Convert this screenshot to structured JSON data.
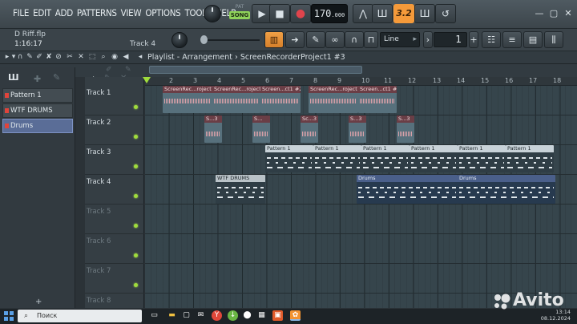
{
  "menu": [
    "FILE",
    "EDIT",
    "ADD",
    "PATTERNS",
    "VIEW",
    "OPTIONS",
    "TOOLS",
    "HELP"
  ],
  "transport": {
    "pat_label": "PAT",
    "song_label": "SONG",
    "play_icon": "play-icon",
    "stop_icon": "stop-icon",
    "record_icon": "record-icon",
    "tempo_int": "170",
    "tempo_frac": ".000",
    "cpu_label": "3.2"
  },
  "info": {
    "filename": "D Riff.flp",
    "time": "1:16:17",
    "hint": "Track 4"
  },
  "snap": {
    "label": "Line",
    "step": "1"
  },
  "playlist": {
    "title": "Playlist - Arrangement",
    "breadcrumb_sep": "›",
    "project": "ScreenRecorderProject1 #3"
  },
  "patterns": [
    {
      "name": "Pattern 1",
      "selected": false
    },
    {
      "name": "WTF DRUMS",
      "selected": false
    },
    {
      "name": "Drums",
      "selected": true
    }
  ],
  "tracks": [
    {
      "name": "Track 1",
      "active": true
    },
    {
      "name": "Track 2",
      "active": true
    },
    {
      "name": "Track 3",
      "active": true
    },
    {
      "name": "Track 4",
      "active": true
    },
    {
      "name": "Track 5",
      "active": false
    },
    {
      "name": "Track 6",
      "active": false
    },
    {
      "name": "Track 7",
      "active": false
    },
    {
      "name": "Track 8",
      "active": false
    }
  ],
  "ruler": [
    "2",
    "3",
    "4",
    "5",
    "6",
    "7",
    "8",
    "9",
    "10",
    "11",
    "12",
    "13",
    "14",
    "15",
    "16",
    "17",
    "18"
  ],
  "clips": {
    "track1": [
      "ScreenRec...roject",
      "ScreenRec...roject",
      "Screen...ct1 #2",
      "ScreenRec...roject",
      "Screen...ct1 #2"
    ],
    "track2": [
      "S...3",
      "S...",
      "Sc...3",
      "S...3",
      "S...3"
    ],
    "track3": [
      "Pattern 1",
      "Pattern 1",
      "Pattern 1",
      "Pattern 1",
      "Pattern 1",
      "Pattern 1"
    ],
    "track4": [
      "WTF DRUMS",
      "Drums",
      "Drums"
    ]
  },
  "taskbar": {
    "search": "Поиск",
    "time": "13:14",
    "date": "08.12.2024"
  },
  "watermark": "Avito"
}
